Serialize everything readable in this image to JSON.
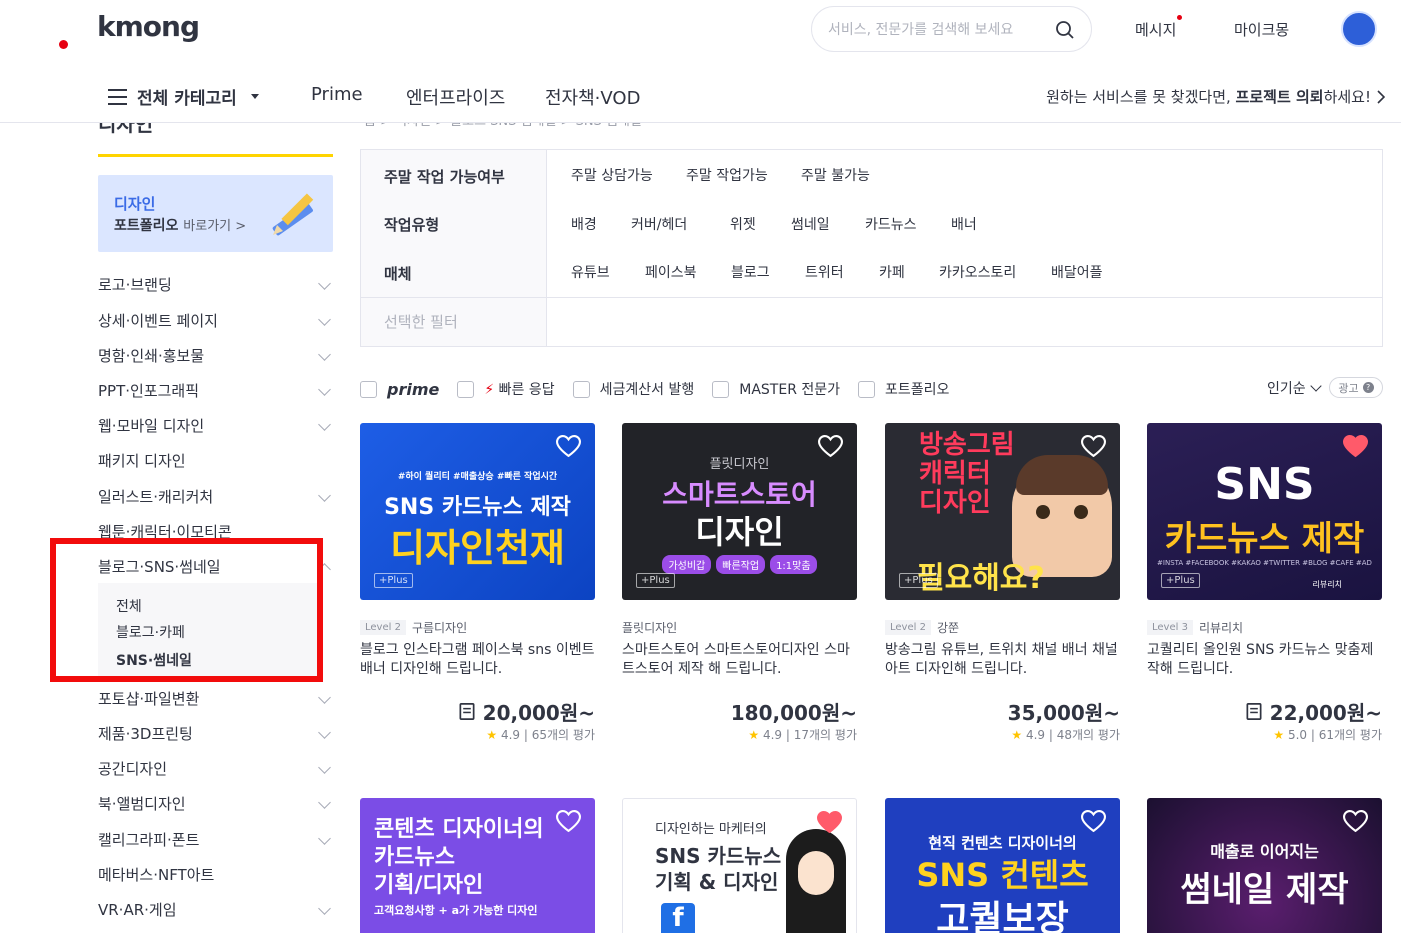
{
  "header": {
    "logo": "kmong",
    "search_placeholder": "서비스, 전문가를 검색해 보세요",
    "message": "메시지",
    "my": "마이크몽",
    "category_button": "전체 카테고리",
    "menu": [
      "Prime",
      "엔터프라이즈",
      "전자책·VOD"
    ],
    "promo_prefix": "원하는 서비스를 못 찾겠다면, ",
    "promo_bold": "프로젝트 의뢰",
    "promo_suffix": "하세요!"
  },
  "sidebar": {
    "title": "디자인",
    "portfolio_line1": "디자인",
    "portfolio_line2": "포트폴리오",
    "portfolio_link": "바로가기 >",
    "items_top": [
      "로고·브랜딩",
      "상세·이벤트 페이지",
      "명함·인쇄·홍보물",
      "PPT·인포그래픽",
      "웹·모바일 디자인",
      "패키지 디자인",
      "일러스트·캐리커처",
      "웹툰·캐릭터·이모티콘"
    ],
    "expanded_item": "블로그·SNS·썸네일",
    "sub_items": [
      "전체",
      "블로그·카페",
      "SNS·썸네일"
    ],
    "items_bottom": [
      "포토샵·파일변환",
      "제품·3D프린팅",
      "공간디자인",
      "북·앨범디자인",
      "캘리그라피·폰트",
      "메타버스·NFT아트",
      "VR·AR·게임"
    ]
  },
  "breadcrumb": "홈 > 디자인 > 블로그·SNS·썸네일 > SNS·썸네일",
  "filters": {
    "rows": [
      {
        "label": "주말 작업 가능여부",
        "options": [
          "주말 상담가능",
          "주말 작업가능",
          "주말 불가능"
        ]
      },
      {
        "label": "작업유형",
        "options": [
          "배경",
          "커버/헤더",
          "위젯",
          "썸네일",
          "카드뉴스",
          "배너"
        ]
      },
      {
        "label": "매체",
        "options": [
          "유튜브",
          "페이스북",
          "블로그",
          "트위터",
          "카페",
          "카카오스토리",
          "배달어플"
        ]
      }
    ],
    "selected_label": "선택한 필터"
  },
  "toggles": {
    "prime": "prime",
    "fast": "빠른 응답",
    "tax": "세금계산서 발행",
    "master": "MASTER 전문가",
    "portfolio": "포트폴리오"
  },
  "sort": {
    "label": "인기순",
    "ad": "광고"
  },
  "cards": [
    {
      "thumb_sub": "#하이 퀄리티 #매출상승 #빠른 작업시간",
      "thumb_title1": "SNS 카드뉴스 제작",
      "thumb_title2": "디자인천재",
      "plus": "+Plus",
      "level": "Level 2",
      "seller": "구름디자인",
      "title": "블로그 인스타그램 페이스북 sns 이벤트 배너 디자인해 드립니다.",
      "price": "20,000원~",
      "rating": "4.9",
      "reviews": "65개의 평가"
    },
    {
      "thumb_sub": "플릿디자인",
      "thumb_title1": "스마트스토어",
      "thumb_title2": "디자인",
      "thumb_tags": [
        "가성비갑",
        "빠른작업",
        "1:1맞춤"
      ],
      "plus": "+Plus",
      "level": "",
      "seller": "플릿디자인",
      "title": "스마트스토어 스마트스토어디자인 스마트스토어 제작 해 드립니다.",
      "price": "180,000원~",
      "rating": "4.9",
      "reviews": "17개의 평가"
    },
    {
      "thumb_title1": "방송그림",
      "thumb_title2": "캐릭터",
      "thumb_title3": "디자인",
      "thumb_title4": "필요해요?",
      "plus": "+Plus",
      "level": "Level 2",
      "seller": "강쭌",
      "title": "방송그림 유튜브, 트위치 채널 배너 채널아트 디자인해 드립니다.",
      "price": "35,000원~",
      "rating": "4.9",
      "reviews": "48개의 평가"
    },
    {
      "thumb_title1": "SNS",
      "thumb_title2": "카드뉴스 제작",
      "thumb_sub": "#INSTA #FACEBOOK #KAKAO #TWITTER #BLOG #CAFE #AD",
      "thumb_brand": "리뷰리치",
      "plus": "+Plus",
      "level": "Level 3",
      "seller": "리뷰리치",
      "title": "고퀄리티 올인원 SNS 카드뉴스 맞춤제작해 드립니다.",
      "price": "22,000원~",
      "rating": "5.0",
      "reviews": "61개의 평가"
    },
    {
      "thumb_title1": "콘텐츠 디자이너의",
      "thumb_title2": "카드뉴스",
      "thumb_title3": "기획/디자인",
      "thumb_sub": "고객요청사항 + a가 가능한 디자인"
    },
    {
      "thumb_title1": "디자인하는 마케터의",
      "thumb_title2": "SNS 카드뉴스",
      "thumb_title3": "기획 & 디자인"
    },
    {
      "thumb_title1": "현직 컨텐츠 디자이너의",
      "thumb_title2": "SNS 컨텐츠",
      "thumb_title3": "고퀄보장"
    },
    {
      "thumb_title1": "매출로 이어지는",
      "thumb_title2": "썸네일 제작"
    }
  ],
  "colors": {
    "accent_red": "#e60012",
    "yellow": "#ffd400",
    "highlight": "#f20c0c",
    "star": "#ffc400"
  }
}
